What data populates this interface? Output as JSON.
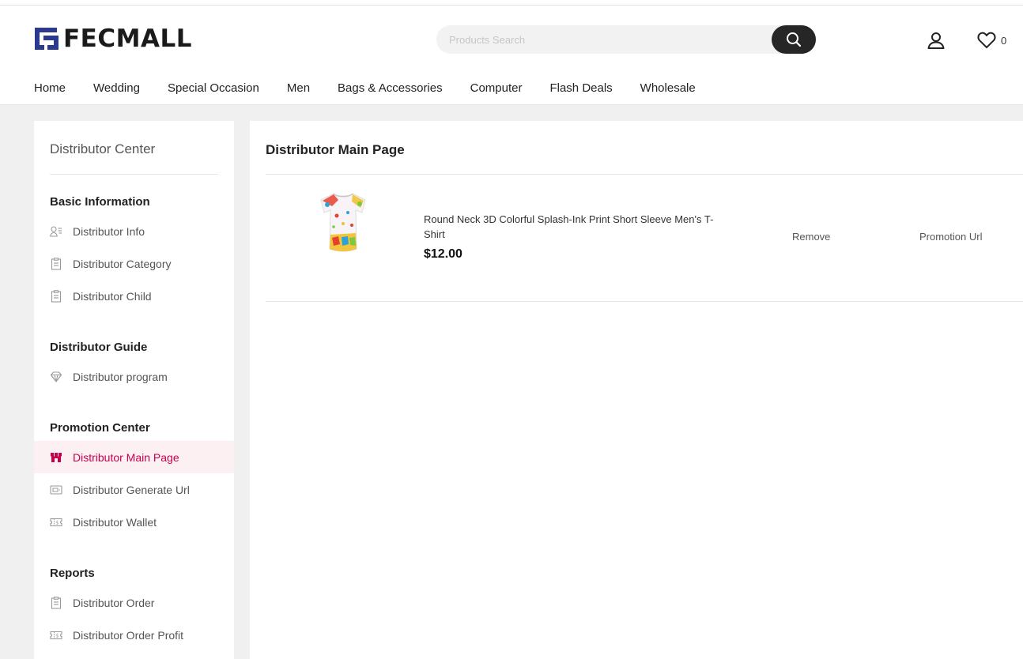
{
  "header": {
    "logo_text": "FECMALL",
    "search_placeholder": "Products Search",
    "wishlist_count": "0",
    "nav": [
      "Home",
      "Wedding",
      "Special Occasion",
      "Men",
      "Bags & Accessories",
      "Computer",
      "Flash Deals",
      "Wholesale"
    ]
  },
  "sidebar": {
    "title": "Distributor Center",
    "groups": [
      {
        "title": "Basic Information",
        "items": [
          {
            "label": "Distributor Info",
            "icon": "user-list-icon"
          },
          {
            "label": "Distributor Category",
            "icon": "clipboard-icon"
          },
          {
            "label": "Distributor Child",
            "icon": "clipboard-icon"
          }
        ]
      },
      {
        "title": "Distributor Guide",
        "items": [
          {
            "label": "Distributor program",
            "icon": "diamond-icon"
          }
        ]
      },
      {
        "title": "Promotion Center",
        "items": [
          {
            "label": "Distributor Main Page",
            "icon": "storefront-icon",
            "active": true
          },
          {
            "label": "Distributor Generate Url",
            "icon": "card-icon"
          },
          {
            "label": "Distributor Wallet",
            "icon": "ticket-icon"
          }
        ]
      },
      {
        "title": "Reports",
        "items": [
          {
            "label": "Distributor Order",
            "icon": "clipboard-icon"
          },
          {
            "label": "Distributor Order Profit",
            "icon": "ticket-icon"
          }
        ]
      }
    ]
  },
  "main": {
    "title": "Distributor Main Page",
    "products": [
      {
        "name": "Round Neck 3D Colorful Splash-Ink Print Short Sleeve Men's T-Shirt",
        "price": "$12.00",
        "remove_label": "Remove",
        "promotion_label": "Promotion Url"
      }
    ]
  },
  "colors": {
    "brand_blue": "#2b3a8f",
    "active_text": "#c8004c",
    "active_bg": "#fdf0f3",
    "search_button": "#262626"
  }
}
